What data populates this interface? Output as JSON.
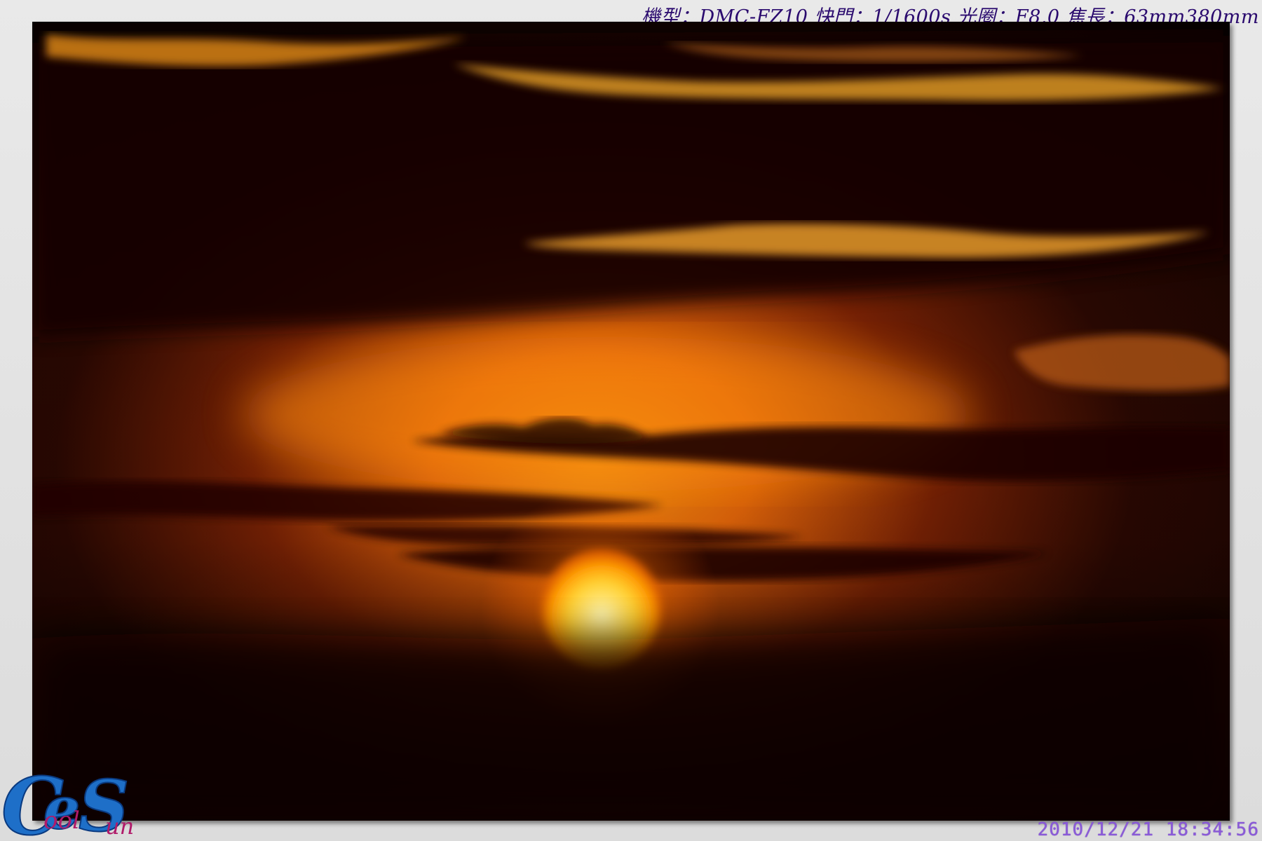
{
  "caption": {
    "exif_text": "機型：DMC-FZ10 快門：1/1600s 光圈：F8.0 焦長：63mm380mm"
  },
  "timestamp": {
    "text": "2010/12/21  18:34:56"
  },
  "logo": {
    "icon": "coolsun-logo",
    "text": "CoolSun",
    "colors": [
      "#1e6fc8",
      "#b01a6a"
    ]
  },
  "photo": {
    "subject": "sunset-over-clouds",
    "colors": {
      "sun_core": "#fff3a0",
      "sun_edge": "#ffb000",
      "glow": "#e86a08",
      "sky_dark": "#1a0500",
      "cloud_dark": "#120300",
      "cloud_rim": "#e8901a"
    }
  }
}
